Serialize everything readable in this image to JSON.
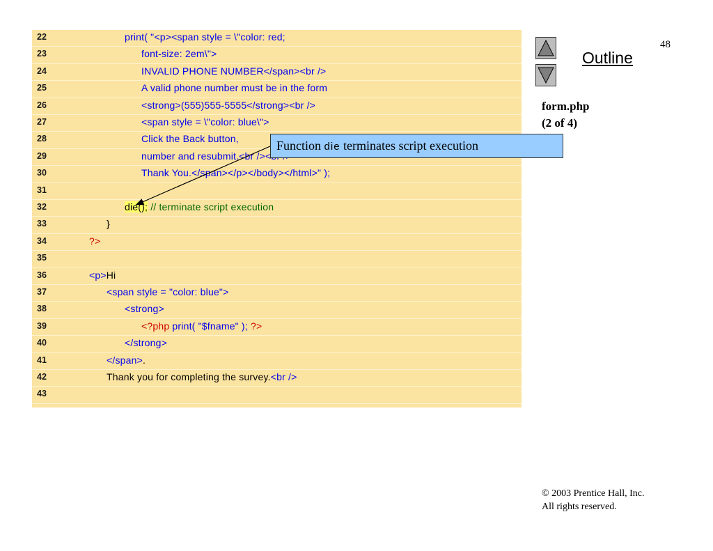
{
  "slide": {
    "page_number": "48",
    "outline_label": "Outline",
    "file_name": "form.php",
    "part": "(2 of 4)",
    "copyright_line1": "© 2003 Prentice Hall, Inc.",
    "copyright_line2": "All rights reserved."
  },
  "callout": {
    "prefix": "Function ",
    "code": "die",
    "suffix": " terminates script execution"
  },
  "code_lines": [
    {
      "num": "22",
      "segs": [
        {
          "t": "print( \"<p><span style = \\\"color: red;",
          "c": "blue"
        }
      ]
    },
    {
      "num": "23",
      "segs": [
        {
          "t": "font-size: 2em\\\">",
          "c": "blue"
        }
      ]
    },
    {
      "num": "24",
      "segs": [
        {
          "t": "INVALID PHONE NUMBER</span><br />",
          "c": "blue"
        }
      ]
    },
    {
      "num": "25",
      "segs": [
        {
          "t": "A valid phone number must be in the form",
          "c": "blue"
        }
      ]
    },
    {
      "num": "26",
      "segs": [
        {
          "t": "<strong>(555)555-5555</strong><br />",
          "c": "blue"
        }
      ]
    },
    {
      "num": "27",
      "segs": [
        {
          "t": "<span style = \\\"color: blue\\\">",
          "c": "blue"
        }
      ]
    },
    {
      "num": "28",
      "segs": [
        {
          "t": "Click the Back button,",
          "c": "blue"
        }
      ]
    },
    {
      "num": "29",
      "segs": [
        {
          "t": "number and resubmit.<br /><br />",
          "c": "blue"
        }
      ]
    },
    {
      "num": "30",
      "segs": [
        {
          "t": "Thank You.</span></p></body></html>\" );",
          "c": "blue"
        }
      ]
    },
    {
      "num": "31",
      "segs": []
    },
    {
      "num": "32",
      "segs": [
        {
          "t": "die();",
          "c": "black",
          "hl": true
        },
        {
          "t": " // terminate script execution",
          "c": "green"
        }
      ]
    },
    {
      "num": "33",
      "segs": [
        {
          "t": "}",
          "c": "black"
        }
      ]
    },
    {
      "num": "34",
      "segs": [
        {
          "t": "?>",
          "c": "red"
        }
      ]
    },
    {
      "num": "35",
      "segs": []
    },
    {
      "num": "36",
      "segs": [
        {
          "t": "<p>",
          "c": "blue"
        },
        {
          "t": "Hi",
          "c": "black"
        }
      ]
    },
    {
      "num": "37",
      "segs": [
        {
          "t": "<span style = \"color: blue\">",
          "c": "blue"
        }
      ]
    },
    {
      "num": "38",
      "segs": [
        {
          "t": "<strong>",
          "c": "blue"
        }
      ]
    },
    {
      "num": "39",
      "segs": [
        {
          "t": "<?php ",
          "c": "red"
        },
        {
          "t": "print( \"$fname\" ); ",
          "c": "blue"
        },
        {
          "t": "?>",
          "c": "red"
        }
      ]
    },
    {
      "num": "40",
      "segs": [
        {
          "t": "</strong>",
          "c": "blue"
        }
      ]
    },
    {
      "num": "41",
      "segs": [
        {
          "t": "</span>",
          "c": "blue"
        },
        {
          "t": ".",
          "c": "black"
        }
      ]
    },
    {
      "num": "42",
      "segs": [
        {
          "t": "Thank you for completing the survey.",
          "c": "black"
        },
        {
          "t": "<br />",
          "c": "blue"
        }
      ]
    },
    {
      "num": "43",
      "segs": []
    }
  ],
  "icons": {
    "prev": "triangle-up-icon",
    "next": "triangle-down-icon"
  }
}
